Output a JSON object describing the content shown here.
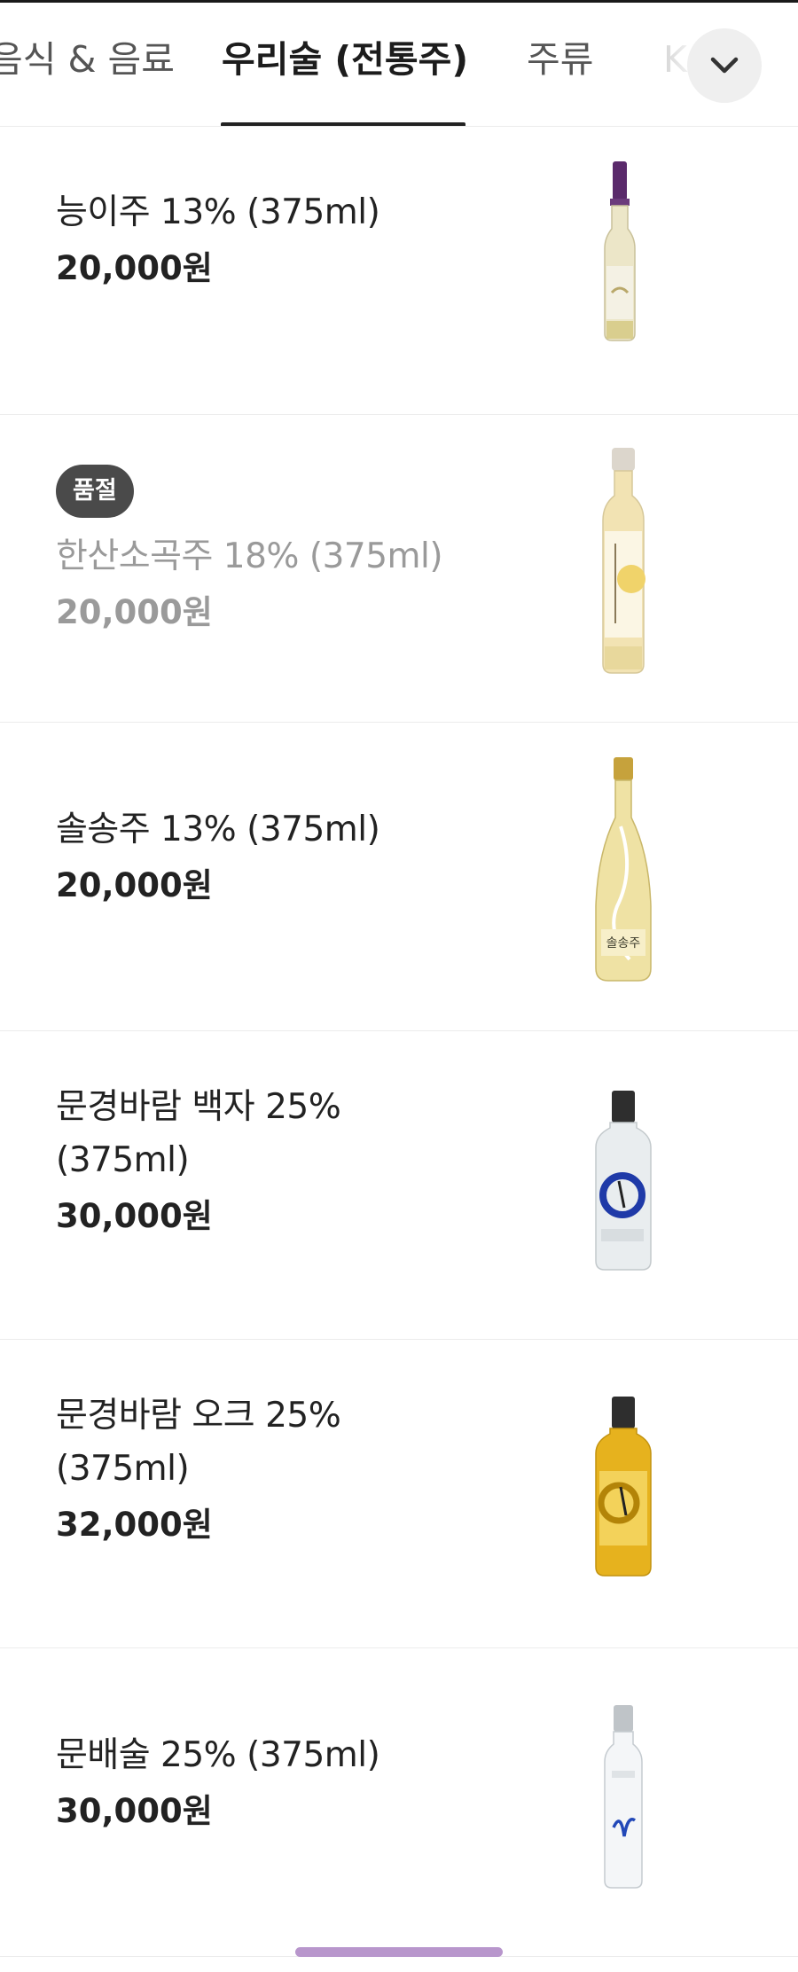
{
  "tabs": [
    {
      "label": "음식 & 음료",
      "selected": false
    },
    {
      "label": "우리술 (전통주)",
      "selected": true
    },
    {
      "label": "주류",
      "selected": false
    },
    {
      "label": "K",
      "selected": false
    }
  ],
  "icons": {
    "expand": "chevron-down-icon"
  },
  "colors": {
    "badge_bg": "#4a4a4a",
    "text_primary": "#222222",
    "text_disabled": "#9a9a9a",
    "home_indicator": "#b896cc"
  },
  "products": [
    {
      "name": "능이주 13% (375ml)",
      "price": "20,000원",
      "badge": "",
      "sold_out": false
    },
    {
      "name": "한산소곡주 18% (375ml)",
      "price": "20,000원",
      "badge": "품절",
      "sold_out": true
    },
    {
      "name": "솔송주 13% (375ml)",
      "price": "20,000원",
      "badge": "",
      "sold_out": false
    },
    {
      "name": "문경바람 백자 25% (375ml)",
      "price": "30,000원",
      "badge": "",
      "sold_out": false
    },
    {
      "name": "문경바람 오크 25% (375ml)",
      "price": "32,000원",
      "badge": "",
      "sold_out": false
    },
    {
      "name": "문배술 25% (375ml)",
      "price": "30,000원",
      "badge": "",
      "sold_out": false
    }
  ]
}
